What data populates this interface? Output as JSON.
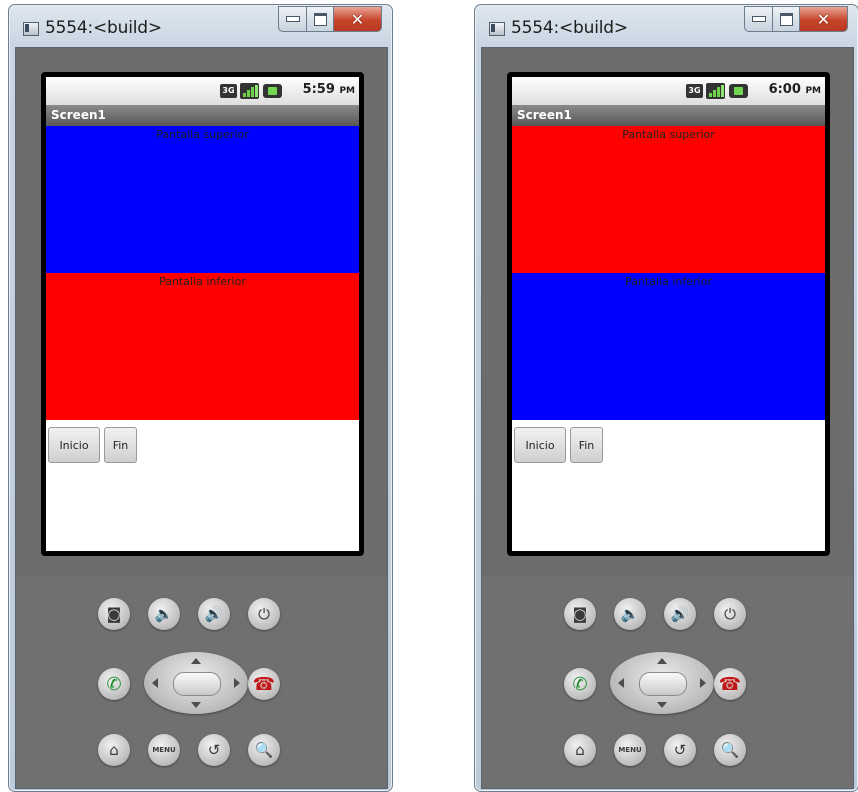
{
  "colors": {
    "blue": "#0000ff",
    "red": "#ff0000"
  },
  "windows": [
    {
      "title": "5554:<build>",
      "status_time": "5:59",
      "status_ampm": "PM",
      "status_network": "3G",
      "app_title": "Screen1",
      "top_panel": {
        "label": "Pantalla superior",
        "color": "#0000ff"
      },
      "bottom_panel": {
        "label": "Pantalla inferior",
        "color": "#ff0000"
      },
      "buttons": {
        "start": "Inicio",
        "end": "Fin"
      },
      "menu_key": "MENU"
    },
    {
      "title": "5554:<build>",
      "status_time": "6:00",
      "status_ampm": "PM",
      "status_network": "3G",
      "app_title": "Screen1",
      "top_panel": {
        "label": "Pantalla superior",
        "color": "#ff0000"
      },
      "bottom_panel": {
        "label": "Pantalla inferior",
        "color": "#0000ff"
      },
      "buttons": {
        "start": "Inicio",
        "end": "Fin"
      },
      "menu_key": "MENU"
    }
  ],
  "icons": [
    "camera-icon",
    "volume-down-icon",
    "volume-up-icon",
    "power-icon",
    "call-icon",
    "end-call-icon",
    "home-icon",
    "back-icon",
    "search-icon"
  ]
}
